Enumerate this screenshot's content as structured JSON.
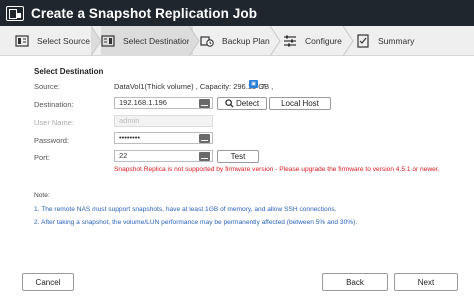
{
  "window": {
    "title": "Create a Snapshot Replication Job"
  },
  "steps": [
    {
      "label": "Select Source",
      "icon": "source-icon"
    },
    {
      "label": "Select Destination",
      "icon": "destination-icon",
      "active": true
    },
    {
      "label": "Backup Plan",
      "icon": "backup-plan-icon"
    },
    {
      "label": "Configure",
      "icon": "configure-icon"
    },
    {
      "label": "Summary",
      "icon": "summary-icon"
    }
  ],
  "form": {
    "section_title": "Select Destination",
    "source": {
      "label": "Source:",
      "value": "DataVol1(Thick volume) , Capacity: 296.12 GB ,",
      "badge_value": "7",
      "badge_icon": "snapshot-icon"
    },
    "destination": {
      "label": "Destination:",
      "value": "192.168.1.196",
      "detect_label": "Detect",
      "local_host_label": "Local Host"
    },
    "user_name": {
      "label": "User Name:",
      "value": "admin"
    },
    "password": {
      "label": "Password:",
      "value": "••••••••"
    },
    "port": {
      "label": "Port:",
      "value": "22",
      "test_label": "Test"
    },
    "error": "Snapshot Replica is not supported by firmware version - Please upgrade the firmware to version 4.5.1 or newer."
  },
  "notes": {
    "title": "Note:",
    "items": [
      "1. The remote NAS must support snapshots, have at least 1GB of memory, and allow SSH connections.",
      "2. After taking a snapshot, the volume/LUN performance may be permanently affected (between 5% and 30%)."
    ]
  },
  "footer": {
    "cancel_label": "Cancel",
    "back_label": "Back",
    "next_label": "Next"
  },
  "colors": {
    "titlebar": "#1f262d",
    "error": "#d71920",
    "note_blue": "#2a63b8",
    "badge": "#2a7fd6"
  }
}
